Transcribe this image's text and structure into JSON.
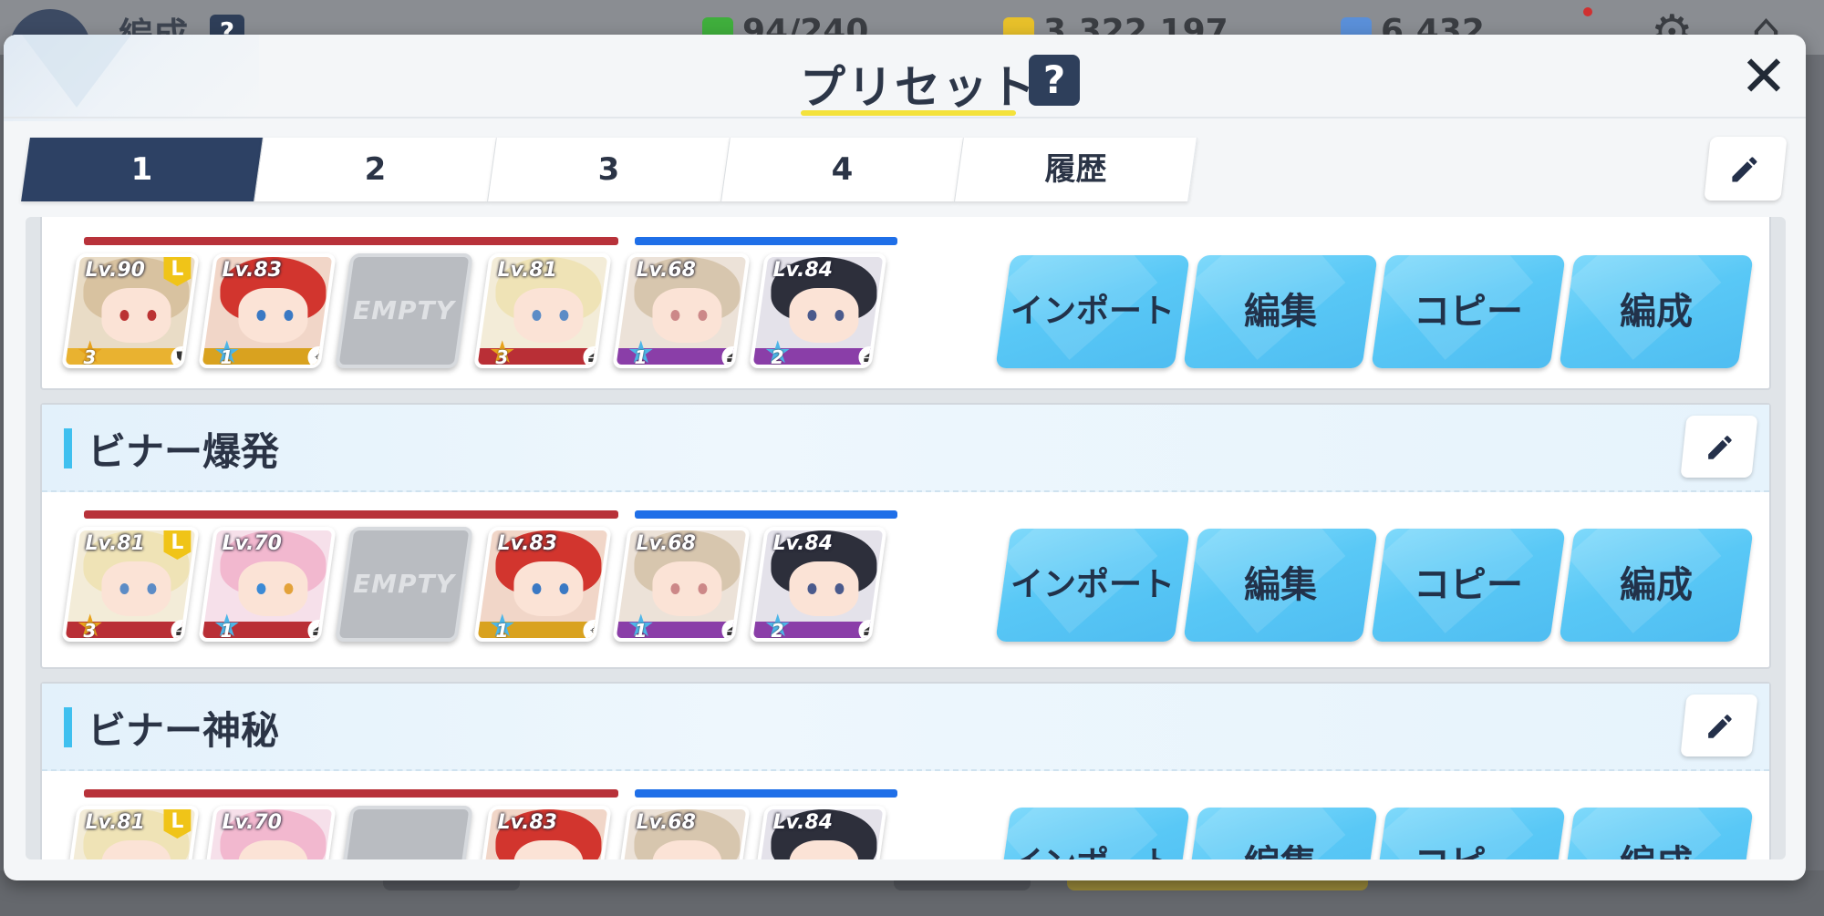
{
  "background": {
    "screen_title": "編成",
    "resources": [
      {
        "icon": "ap-icon",
        "value": "94/240",
        "color": "#3fae3c"
      },
      {
        "icon": "credit-icon",
        "value": "3,322,197",
        "color": "#e7c02a"
      },
      {
        "icon": "pyroxene-icon",
        "value": "6,432",
        "color": "#5a8fd8"
      }
    ]
  },
  "dialog": {
    "title": "プリセット",
    "help": "?",
    "close": "✕"
  },
  "tabs": [
    {
      "label": "1",
      "active": true
    },
    {
      "label": "2",
      "active": false
    },
    {
      "label": "3",
      "active": false
    },
    {
      "label": "4",
      "active": false
    },
    {
      "label": "履歴",
      "active": false
    }
  ],
  "actions": {
    "import": "インポート",
    "edit": "編集",
    "copy": "コピー",
    "formation": "編成"
  },
  "empty_label": "EMPTY",
  "presets": [
    {
      "name": "",
      "students": [
        {
          "level": "Lv.90",
          "stars": "3",
          "leader": "L",
          "role": "shield-icon"
        },
        {
          "level": "Lv.83",
          "stars": "1",
          "role": "crosshair-icon"
        },
        {
          "empty": true
        },
        {
          "level": "Lv.81",
          "stars": "3",
          "role": "support-icon"
        },
        {
          "level": "Lv.68",
          "stars": "1",
          "role": "support-icon"
        },
        {
          "level": "Lv.84",
          "stars": "2",
          "role": "support-icon"
        }
      ]
    },
    {
      "name": "ビナー爆発",
      "students": [
        {
          "level": "Lv.81",
          "stars": "3",
          "leader": "L",
          "role": "support-icon"
        },
        {
          "level": "Lv.70",
          "stars": "1",
          "role": "support-icon"
        },
        {
          "empty": true
        },
        {
          "level": "Lv.83",
          "stars": "1",
          "role": "crosshair-icon"
        },
        {
          "level": "Lv.68",
          "stars": "1",
          "role": "support-icon"
        },
        {
          "level": "Lv.84",
          "stars": "2",
          "role": "support-icon"
        }
      ]
    },
    {
      "name": "ビナー神秘",
      "students": [
        {
          "level": "Lv.81",
          "leader": "L"
        },
        {
          "level": "Lv.70"
        },
        {
          "empty": true
        },
        {
          "level": "Lv.83"
        },
        {
          "level": "Lv.68"
        },
        {
          "level": "Lv.84"
        }
      ]
    }
  ]
}
